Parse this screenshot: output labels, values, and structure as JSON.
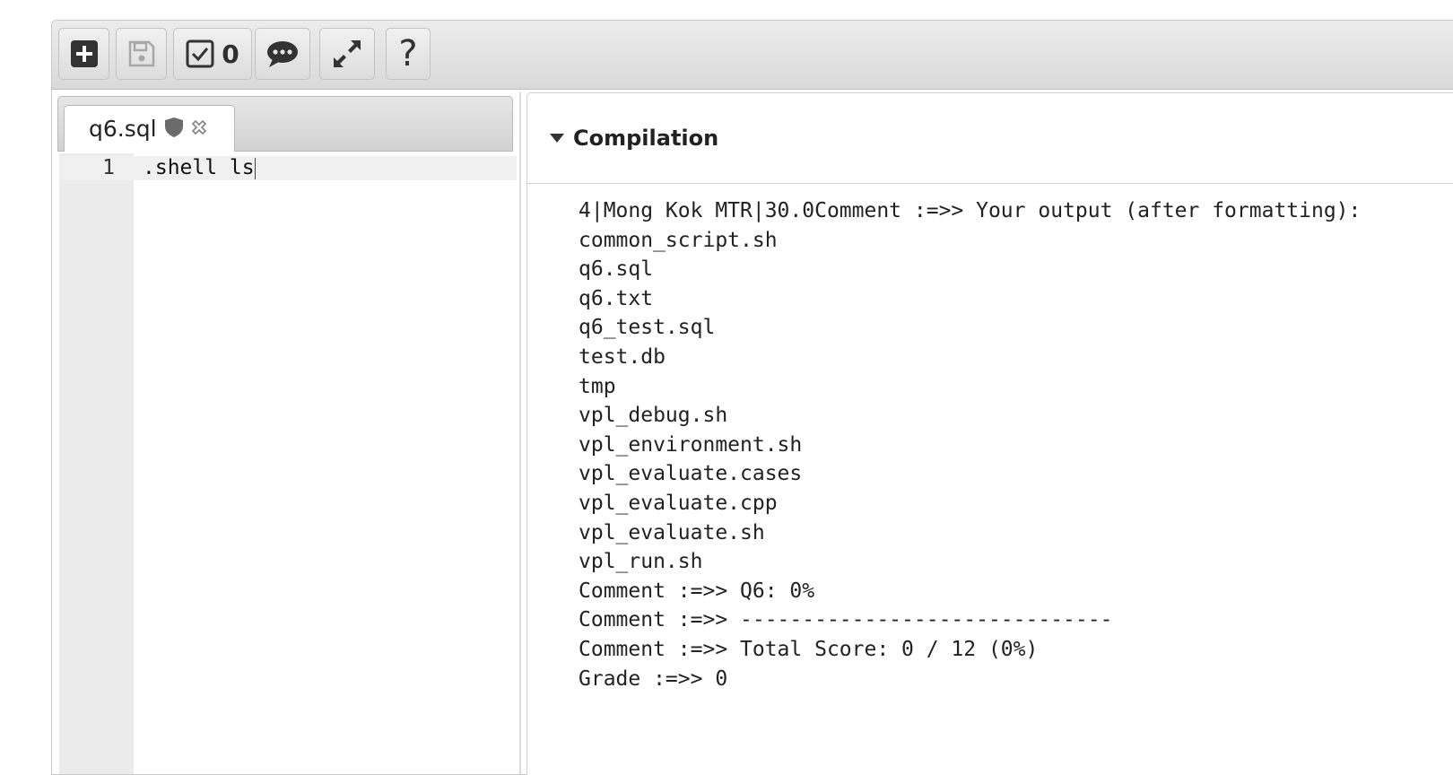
{
  "toolbar": {
    "buttons": [
      {
        "name": "new-file",
        "icon": "plus-square-icon"
      },
      {
        "name": "save",
        "icon": "floppy-disk-icon",
        "disabled": true
      },
      {
        "name": "evaluate",
        "icon": "checkbox-icon",
        "count": "0"
      },
      {
        "name": "comments",
        "icon": "speech-bubble-icon"
      },
      {
        "name": "fullscreen",
        "icon": "expand-arrows-icon"
      },
      {
        "name": "help",
        "icon": "question-icon",
        "label": "?"
      }
    ]
  },
  "editor": {
    "tab": {
      "filename": "q6.sql",
      "icons": [
        "shield-icon",
        "close-icon"
      ]
    },
    "lines": [
      {
        "number": "1",
        "text": ".shell ls"
      }
    ]
  },
  "compilation": {
    "title": "Compilation",
    "output_lines": [
      "4|Mong Kok MTR|30.0Comment :=>> Your output (after formatting):",
      "common_script.sh",
      "q6.sql",
      "q6.txt",
      "q6_test.sql",
      "test.db",
      "tmp",
      "vpl_debug.sh",
      "vpl_environment.sh",
      "vpl_evaluate.cases",
      "vpl_evaluate.cpp",
      "vpl_evaluate.sh",
      "vpl_run.sh",
      "Comment :=>> Q6: 0%",
      "Comment :=>> ------------------------------",
      "Comment :=>> Total Score: 0 / 12 (0%)",
      "Grade :=>> 0"
    ]
  },
  "colors": {
    "toolbar_bg": "#dedede",
    "icon_dark": "#333333",
    "icon_disabled": "#a8a8a8",
    "gutter_bg": "#ebebeb"
  }
}
